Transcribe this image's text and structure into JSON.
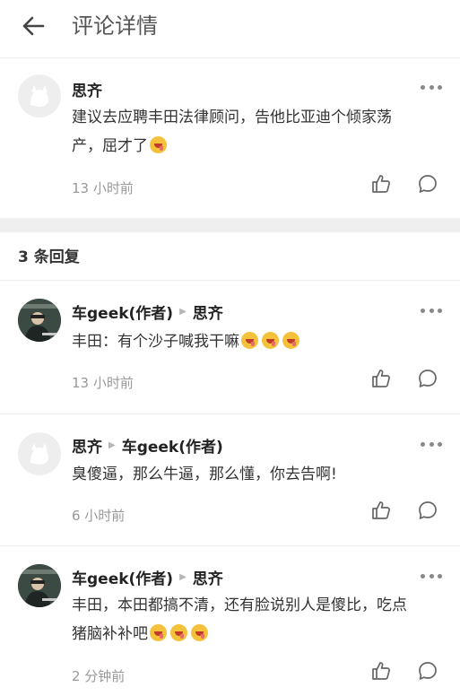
{
  "header": {
    "title": "评论详情"
  },
  "main_comment": {
    "user": "思齐",
    "text_line1": "建议去应聘丰田法律顾问，告他比亚迪个倾家荡",
    "text_line2": "产，屈才了",
    "time": "13 小时前"
  },
  "replies_count_label": "3 条回复",
  "replies": [
    {
      "user": "车geek(作者)",
      "to": "思齐",
      "text": "丰田：有个沙子喊我干嘛",
      "time": "13 小时前"
    },
    {
      "user": "思齐",
      "to": "车geek(作者)",
      "text": "臭傻逼，那么牛逼，那么懂，你去告啊!",
      "time": "6 小时前"
    },
    {
      "user": "车geek(作者)",
      "to": "思齐",
      "text_line1": "丰田，本田都搞不清，还有脸说别人是傻比，吃点",
      "text_line2": "猪脑补补吧",
      "time": "2 分钟前"
    }
  ]
}
